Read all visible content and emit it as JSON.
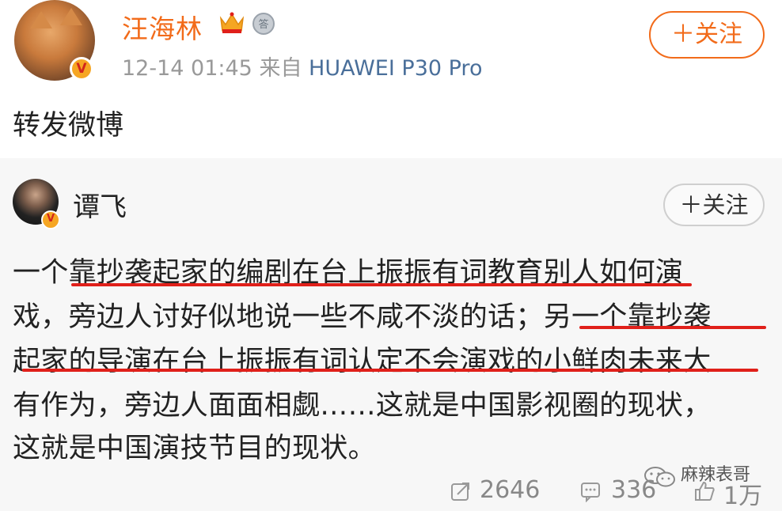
{
  "post": {
    "username": "汪海林",
    "time": "12-14 01:45",
    "source_prefix": "来自",
    "device": "HUAWEI P30 Pro",
    "follow_label": "＋关注",
    "repost_text": "转发微博"
  },
  "original": {
    "author": "谭飞",
    "follow_label": "＋关注",
    "lines": [
      "一个靠抄袭起家的编剧在台上振振有词教育别人如何演",
      "戏，旁边人讨好似地说一些不咸不淡的话；另一个靠抄袭",
      "起家的导演在台上振振有词认定不会演戏的小鲜肉未来大",
      "有作为，旁边人面面相觑……这就是中国影视圈的现状，",
      "这就是中国演技节目的现状。"
    ]
  },
  "stats": {
    "reposts": "2646",
    "comments": "336",
    "likes": "1万"
  },
  "watermark": "麻辣表哥",
  "colors": {
    "accent_orange": "#f26b1a",
    "link_blue": "#4a6f9a",
    "underline_red": "#e0201a",
    "card_bg": "#f7f7f7"
  },
  "icons": {
    "verified": "v-badge-icon",
    "crown": "crown-icon",
    "medal": "medal-icon",
    "repost": "repost-icon",
    "comment": "comment-icon",
    "like": "like-icon",
    "watermark": "wechat-icon"
  },
  "badge_text": {
    "verified": "V",
    "medal": "答"
  }
}
